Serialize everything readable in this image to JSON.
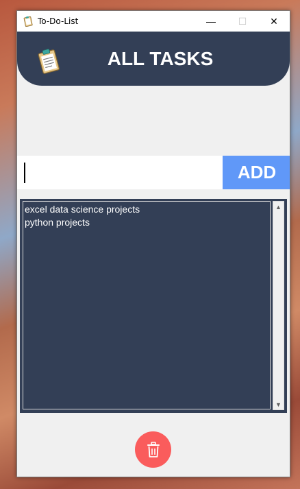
{
  "window": {
    "title": "To-Do-List",
    "controls": {
      "minimize": "—",
      "maximize": "☐",
      "close": "✕"
    }
  },
  "header": {
    "title": "ALL TASKS",
    "icon": "clipboard-icon"
  },
  "task_input": {
    "value": "",
    "placeholder": ""
  },
  "add_button": {
    "label": "ADD"
  },
  "tasks": {
    "items": [
      "excel data science projects",
      "python projects"
    ]
  },
  "scrollbar": {
    "up": "▲",
    "down": "▼"
  },
  "delete_button": {
    "icon": "trash-icon"
  },
  "colors": {
    "header_bg": "#333f56",
    "list_bg": "#333f56",
    "add_button_bg": "#6098f8",
    "delete_button_bg": "#fa5c5c",
    "window_bg": "#f0f0f0"
  }
}
